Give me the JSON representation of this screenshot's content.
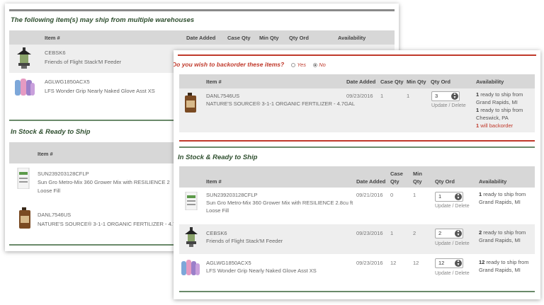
{
  "back_panel": {
    "multi_title": "The following item(s) may ship from multiple warehouses",
    "headers": {
      "item": "Item #",
      "date": "Date Added",
      "case": "Case Qty",
      "min": "Min Qty",
      "qty": "Qty Ord",
      "avail": "Availability"
    },
    "multi_rows": [
      {
        "sku": "CEBSK6",
        "name": "Friends of Flight Stack'M Feeder",
        "icon": "bird-feeder-icon"
      },
      {
        "sku": "AGLWG1850ACX5",
        "name": "LFS Wonder Grip Nearly Naked Glove Asst XS",
        "icon": "gloves-icon"
      }
    ],
    "stock_title": "In Stock & Ready to Ship",
    "stock_rows": [
      {
        "sku": "SUN239203128CFLP",
        "name": "Sun Gro Metro-Mix 360 Grower Mix with RESILIENCE 2",
        "name2": "Loose Fill",
        "icon": "soil-bag-icon"
      },
      {
        "sku": "DANL7546US",
        "name": "NATURE'S SOURCE® 3-1-1 ORGANIC FERTILIZER - 4.7",
        "icon": "fertilizer-jug-icon"
      }
    ]
  },
  "front_panel": {
    "backorder_question": "Do you wish to backorder these items?",
    "yes_label": "Yes",
    "no_label": "No",
    "headers": {
      "item": "Item #",
      "date": "Date Added",
      "case": "Case Qty",
      "min": "Min Qty",
      "qty": "Qty Ord",
      "avail": "Availability"
    },
    "backorder_row": {
      "sku": "DANL7546US",
      "name": "NATURE'S SOURCE® 3-1-1 ORGANIC FERTILIZER - 4.7GAL",
      "date": "09/23/2016",
      "case": "1",
      "min": "1",
      "qty": "3",
      "update": "Update / Delete",
      "avail1_n": "1",
      "avail1_t": "ready to ship from",
      "avail1_loc": "Grand Rapids, MI",
      "avail2_n": "1",
      "avail2_t": "ready to ship from",
      "avail2_loc": "Cheswick, PA",
      "avail3_n": "1",
      "avail3_t": "will backorder",
      "icon": "fertilizer-jug-icon"
    },
    "stock_title": "In Stock & Ready to Ship",
    "stock_headers": {
      "item": "Item #",
      "date": "Date Added",
      "case1": "Case",
      "case2": "Qty",
      "min1": "Min",
      "min2": "Qty",
      "qty": "Qty Ord",
      "avail": "Availability"
    },
    "stock_rows": [
      {
        "sku": "SUN239203128CFLP",
        "name": "Sun Gro Metro-Mix 360 Grower Mix with RESILIENCE 2.8cu ft",
        "name2": "Loose Fill",
        "date": "09/21/2016",
        "case": "0",
        "min": "1",
        "qty": "1",
        "update": "Update / Delete",
        "avail_n": "1",
        "avail_t": "ready to ship from",
        "avail_loc": "Grand Rapids, MI",
        "icon": "soil-bag-icon"
      },
      {
        "sku": "CEBSK6",
        "name": "Friends of Flight Stack'M Feeder",
        "name2": "",
        "date": "09/23/2016",
        "case": "1",
        "min": "2",
        "qty": "2",
        "update": "Update / Delete",
        "avail_n": "2",
        "avail_t": "ready to ship from",
        "avail_loc": "Grand Rapids, MI",
        "icon": "bird-feeder-icon"
      },
      {
        "sku": "AGLWG1850ACX5",
        "name": "LFS Wonder Grip Nearly Naked Glove Asst XS",
        "name2": "",
        "date": "09/23/2016",
        "case": "12",
        "min": "12",
        "qty": "12",
        "update": "Update / Delete",
        "avail_n": "12",
        "avail_t": "ready to ship from",
        "avail_loc": "Grand Rapids, MI",
        "icon": "gloves-icon"
      }
    ]
  },
  "colors": {
    "accent_green": "#2f4f2f",
    "backorder_red": "#c0392b",
    "header_gray": "#d7d7d7"
  }
}
